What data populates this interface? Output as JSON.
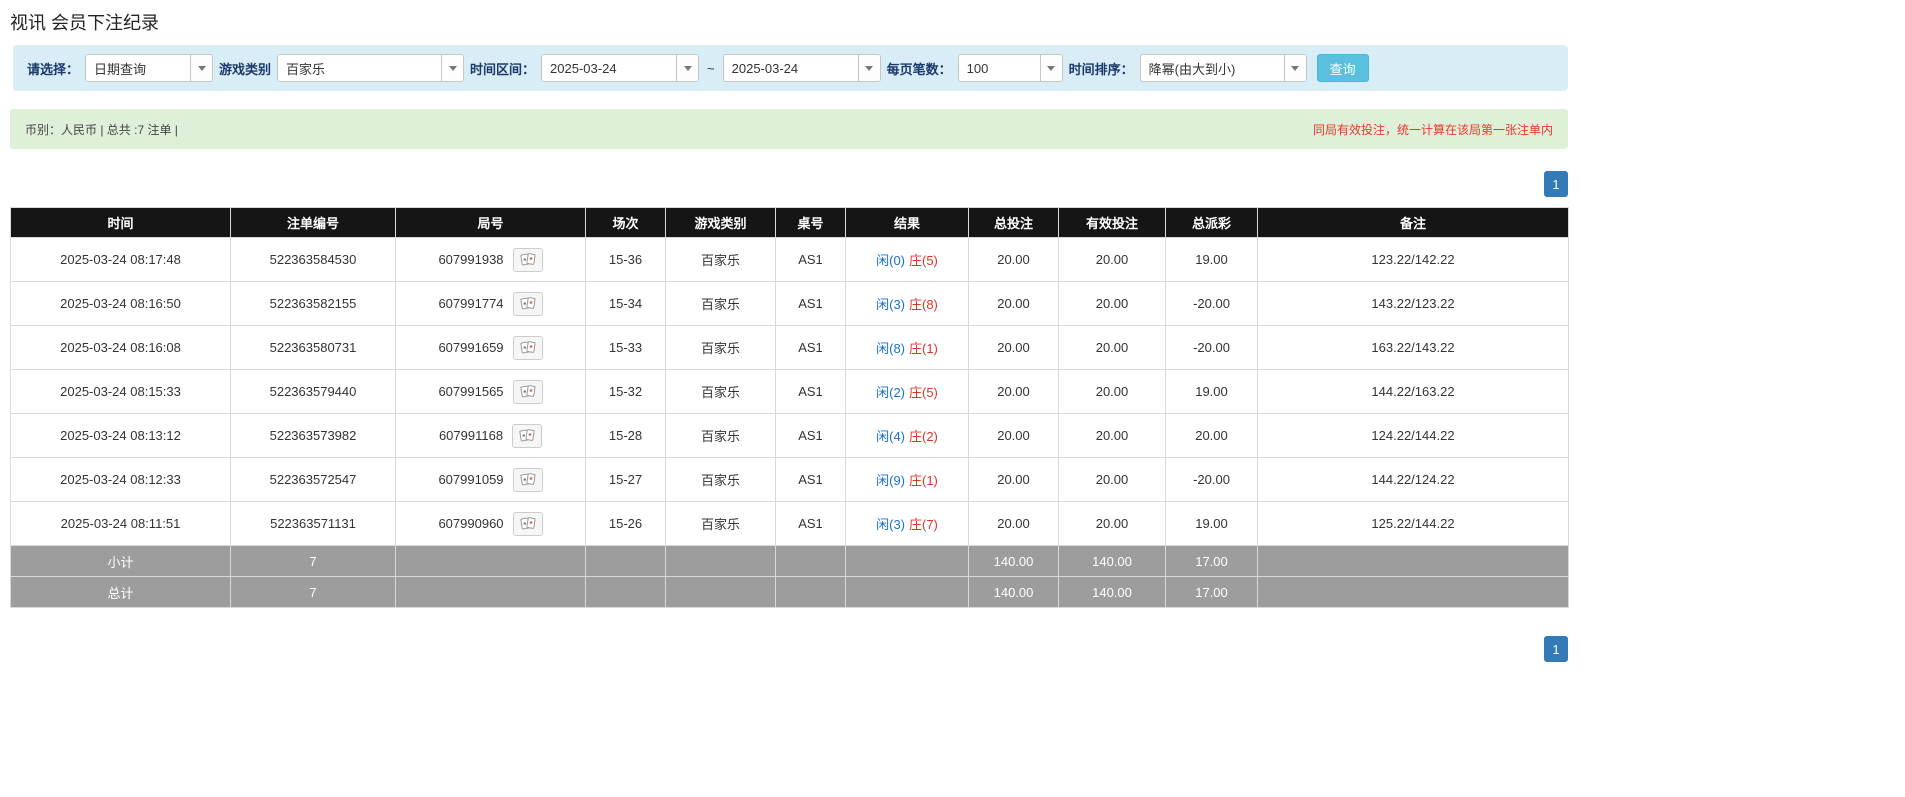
{
  "page": {
    "title": "视讯 会员下注纪录"
  },
  "filters": {
    "select_label": "请选择：",
    "select_value": "日期查询",
    "game_type_label": "游戏类别",
    "game_type_value": "百家乐",
    "range_label": "时间区间：",
    "date_from": "2025-03-24",
    "tilde": "~",
    "date_to": "2025-03-24",
    "page_size_label": "每页笔数：",
    "page_size_value": "100",
    "sort_label": "时间排序：",
    "sort_value": "降幂(由大到小)",
    "search_button": "查询"
  },
  "summary": {
    "left": "币别：人民币 | 总共 :7 注单 |",
    "note": "同局有效投注，统一计算在该局第一张注单内"
  },
  "pagination": {
    "page": "1"
  },
  "table": {
    "headers": [
      "时间",
      "注单编号",
      "局号",
      "场次",
      "游戏类别",
      "桌号",
      "结果",
      "总投注",
      "有效投注",
      "总派彩",
      "备注"
    ],
    "rows": [
      {
        "time": "2025-03-24 08:17:48",
        "bet_id": "522363584530",
        "round_id": "607991938",
        "session": "15-36",
        "game": "百家乐",
        "table_no": "AS1",
        "result_player": "闲(0)",
        "result_banker": "庄(5)",
        "total_bet": "20.00",
        "valid_bet": "20.00",
        "payout": "19.00",
        "remark": "123.22/142.22"
      },
      {
        "time": "2025-03-24 08:16:50",
        "bet_id": "522363582155",
        "round_id": "607991774",
        "session": "15-34",
        "game": "百家乐",
        "table_no": "AS1",
        "result_player": "闲(3)",
        "result_banker": "庄(8)",
        "total_bet": "20.00",
        "valid_bet": "20.00",
        "payout": "-20.00",
        "remark": "143.22/123.22"
      },
      {
        "time": "2025-03-24 08:16:08",
        "bet_id": "522363580731",
        "round_id": "607991659",
        "session": "15-33",
        "game": "百家乐",
        "table_no": "AS1",
        "result_player": "闲(8)",
        "result_banker": "庄(1)",
        "total_bet": "20.00",
        "valid_bet": "20.00",
        "payout": "-20.00",
        "remark": "163.22/143.22"
      },
      {
        "time": "2025-03-24 08:15:33",
        "bet_id": "522363579440",
        "round_id": "607991565",
        "session": "15-32",
        "game": "百家乐",
        "table_no": "AS1",
        "result_player": "闲(2)",
        "result_banker": "庄(5)",
        "total_bet": "20.00",
        "valid_bet": "20.00",
        "payout": "19.00",
        "remark": "144.22/163.22"
      },
      {
        "time": "2025-03-24 08:13:12",
        "bet_id": "522363573982",
        "round_id": "607991168",
        "session": "15-28",
        "game": "百家乐",
        "table_no": "AS1",
        "result_player": "闲(4)",
        "result_banker": "庄(2)",
        "total_bet": "20.00",
        "valid_bet": "20.00",
        "payout": "20.00",
        "remark": "124.22/144.22"
      },
      {
        "time": "2025-03-24 08:12:33",
        "bet_id": "522363572547",
        "round_id": "607991059",
        "session": "15-27",
        "game": "百家乐",
        "table_no": "AS1",
        "result_player": "闲(9)",
        "result_banker": "庄(1)",
        "total_bet": "20.00",
        "valid_bet": "20.00",
        "payout": "-20.00",
        "remark": "144.22/124.22"
      },
      {
        "time": "2025-03-24 08:11:51",
        "bet_id": "522363571131",
        "round_id": "607990960",
        "session": "15-26",
        "game": "百家乐",
        "table_no": "AS1",
        "result_player": "闲(3)",
        "result_banker": "庄(7)",
        "total_bet": "20.00",
        "valid_bet": "20.00",
        "payout": "19.00",
        "remark": "125.22/144.22"
      }
    ],
    "subtotal": {
      "label": "小计",
      "count": "7",
      "total_bet": "140.00",
      "valid_bet": "140.00",
      "payout": "17.00"
    },
    "total": {
      "label": "总计",
      "count": "7",
      "total_bet": "140.00",
      "valid_bet": "140.00",
      "payout": "17.00"
    }
  },
  "colors": {
    "filter_bar_bg": "#d9edf7",
    "summary_bar_bg": "#dff0d8",
    "note_red": "#e8372d",
    "header_bg": "#151515",
    "footer_bg": "#9d9d9d",
    "search_button_bg": "#5bc0de",
    "pagination_active_bg": "#337ab7",
    "amount_link_blue": "#2a7ab9",
    "player_blue": "#1a6fd4",
    "banker_red": "#e0342b",
    "negative_red": "#e0342b"
  }
}
